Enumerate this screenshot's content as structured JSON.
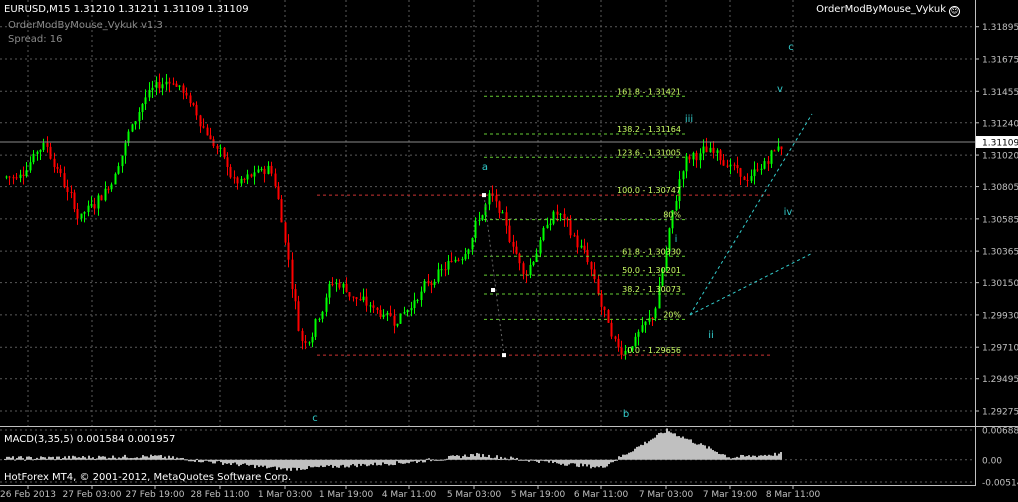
{
  "symbol_header": "EURUSD,M15  1.31210 1.31211 1.31109 1.31109",
  "ea": {
    "name": "OrderModByMouse_Vykuk v1.3",
    "spread": "Spread: 16",
    "badge": "OrderModByMouse_Vykuk"
  },
  "macd": {
    "label": "MACD(3,35,5) 0.001584 0.001957",
    "scale": [
      "0.006885",
      "0.00",
      "-0.005144"
    ]
  },
  "broker_label": "HotForex MT4, © 2001-2012, MetaQuotes Software Corp.",
  "price_axis": [
    "1.31895",
    "1.31675",
    "1.31455",
    "1.31240",
    "1.31020",
    "1.30805",
    "1.30585",
    "1.30365",
    "1.30150",
    "1.29930",
    "1.29710",
    "1.29495",
    "1.29275"
  ],
  "current_price": "1.31109",
  "time_axis": [
    "26 Feb 2013",
    "27 Feb 03:00",
    "27 Feb 19:00",
    "28 Feb 11:00",
    "1 Mar 03:00",
    "1 Mar 19:00",
    "4 Mar 11:00",
    "5 Mar 03:00",
    "5 Mar 19:00",
    "6 Mar 11:00",
    "7 Mar 03:00",
    "7 Mar 19:00",
    "8 Mar 11:00"
  ],
  "fibo_levels": [
    "161.8 - 1.31421",
    "138.2 - 1.31164",
    "123.6 - 1.31005",
    "100.0 - 1.30747",
    "80%",
    "61.8 - 1.30330",
    "50.0 - 1.30201",
    "38.2 - 1.30073",
    "20%",
    "0.0 - 1.29656"
  ],
  "wave_labels": [
    "a",
    "b",
    "c",
    "c",
    "i",
    "ii",
    "iii",
    "iv",
    "v"
  ],
  "colors": {
    "background": "#000000",
    "bull_candle": "#00ff00",
    "bear_candle": "#ff0000",
    "fibo_line": "#66cc33",
    "fibo_text": "#ccff66",
    "zero_hundred_line": "#cc3333",
    "trendline": "#33cccc",
    "wave_label": "#33cccc",
    "macd_histogram": "#c0c0c0",
    "axis_text": "#c0c0c0"
  },
  "chart_data": {
    "type": "candlestick",
    "symbol": "EURUSD",
    "timeframe": "M15",
    "ylim": [
      1.292,
      1.3205
    ],
    "path": [
      {
        "x": "26 Feb 2013",
        "y": 1.3087
      },
      {
        "x": "26 Feb 2013",
        "y": 1.3112
      },
      {
        "x": "27 Feb 03:00",
        "y": 1.3058
      },
      {
        "x": "27 Feb 03:00",
        "y": 1.3082
      },
      {
        "x": "27 Feb 19:00",
        "y": 1.314
      },
      {
        "x": "27 Feb 19:00",
        "y": 1.3156
      },
      {
        "x": "28 Feb 11:00",
        "y": 1.3118
      },
      {
        "x": "28 Feb 11:00",
        "y": 1.308
      },
      {
        "x": "1 Mar 03:00",
        "y": 1.3095
      },
      {
        "x": "1 Mar 03:00",
        "y": 1.3036
      },
      {
        "x": "1 Mar 03:00",
        "y": 1.2968
      },
      {
        "x": "1 Mar 19:00",
        "y": 1.3018
      },
      {
        "x": "1 Mar 19:00",
        "y": 1.3
      },
      {
        "x": "4 Mar 11:00",
        "y": 1.299
      },
      {
        "x": "4 Mar 11:00",
        "y": 1.3012
      },
      {
        "x": "5 Mar 03:00",
        "y": 1.3035
      },
      {
        "x": "5 Mar 03:00",
        "y": 1.3075
      },
      {
        "x": "5 Mar 19:00",
        "y": 1.302
      },
      {
        "x": "5 Mar 19:00",
        "y": 1.3045
      },
      {
        "x": "5 Mar 19:00",
        "y": 1.3065
      },
      {
        "x": "6 Mar 11:00",
        "y": 1.303
      },
      {
        "x": "6 Mar 11:00",
        "y": 1.2994
      },
      {
        "x": "6 Mar 11:00",
        "y": 1.2966
      },
      {
        "x": "7 Mar 03:00",
        "y": 1.299
      },
      {
        "x": "7 Mar 03:00",
        "y": 1.31
      },
      {
        "x": "7 Mar 19:00",
        "y": 1.3105
      },
      {
        "x": "7 Mar 19:00",
        "y": 1.3082
      },
      {
        "x": "8 Mar 11:00",
        "y": 1.311
      },
      {
        "x": "8 Mar 11:00",
        "y": 1.3111
      }
    ],
    "macd_histogram": [
      {
        "x": "26 Feb 2013",
        "y": 0.0004
      },
      {
        "x": "27 Feb 19:00",
        "y": 0.0008
      },
      {
        "x": "1 Mar 03:00",
        "y": -0.0022
      },
      {
        "x": "4 Mar 11:00",
        "y": -0.0006
      },
      {
        "x": "5 Mar 03:00",
        "y": 0.0012
      },
      {
        "x": "6 Mar 11:00",
        "y": -0.0018
      },
      {
        "x": "7 Mar 03:00",
        "y": 0.0068
      },
      {
        "x": "7 Mar 19:00",
        "y": 0.0005
      },
      {
        "x": "8 Mar 11:00",
        "y": 0.0016
      }
    ]
  }
}
